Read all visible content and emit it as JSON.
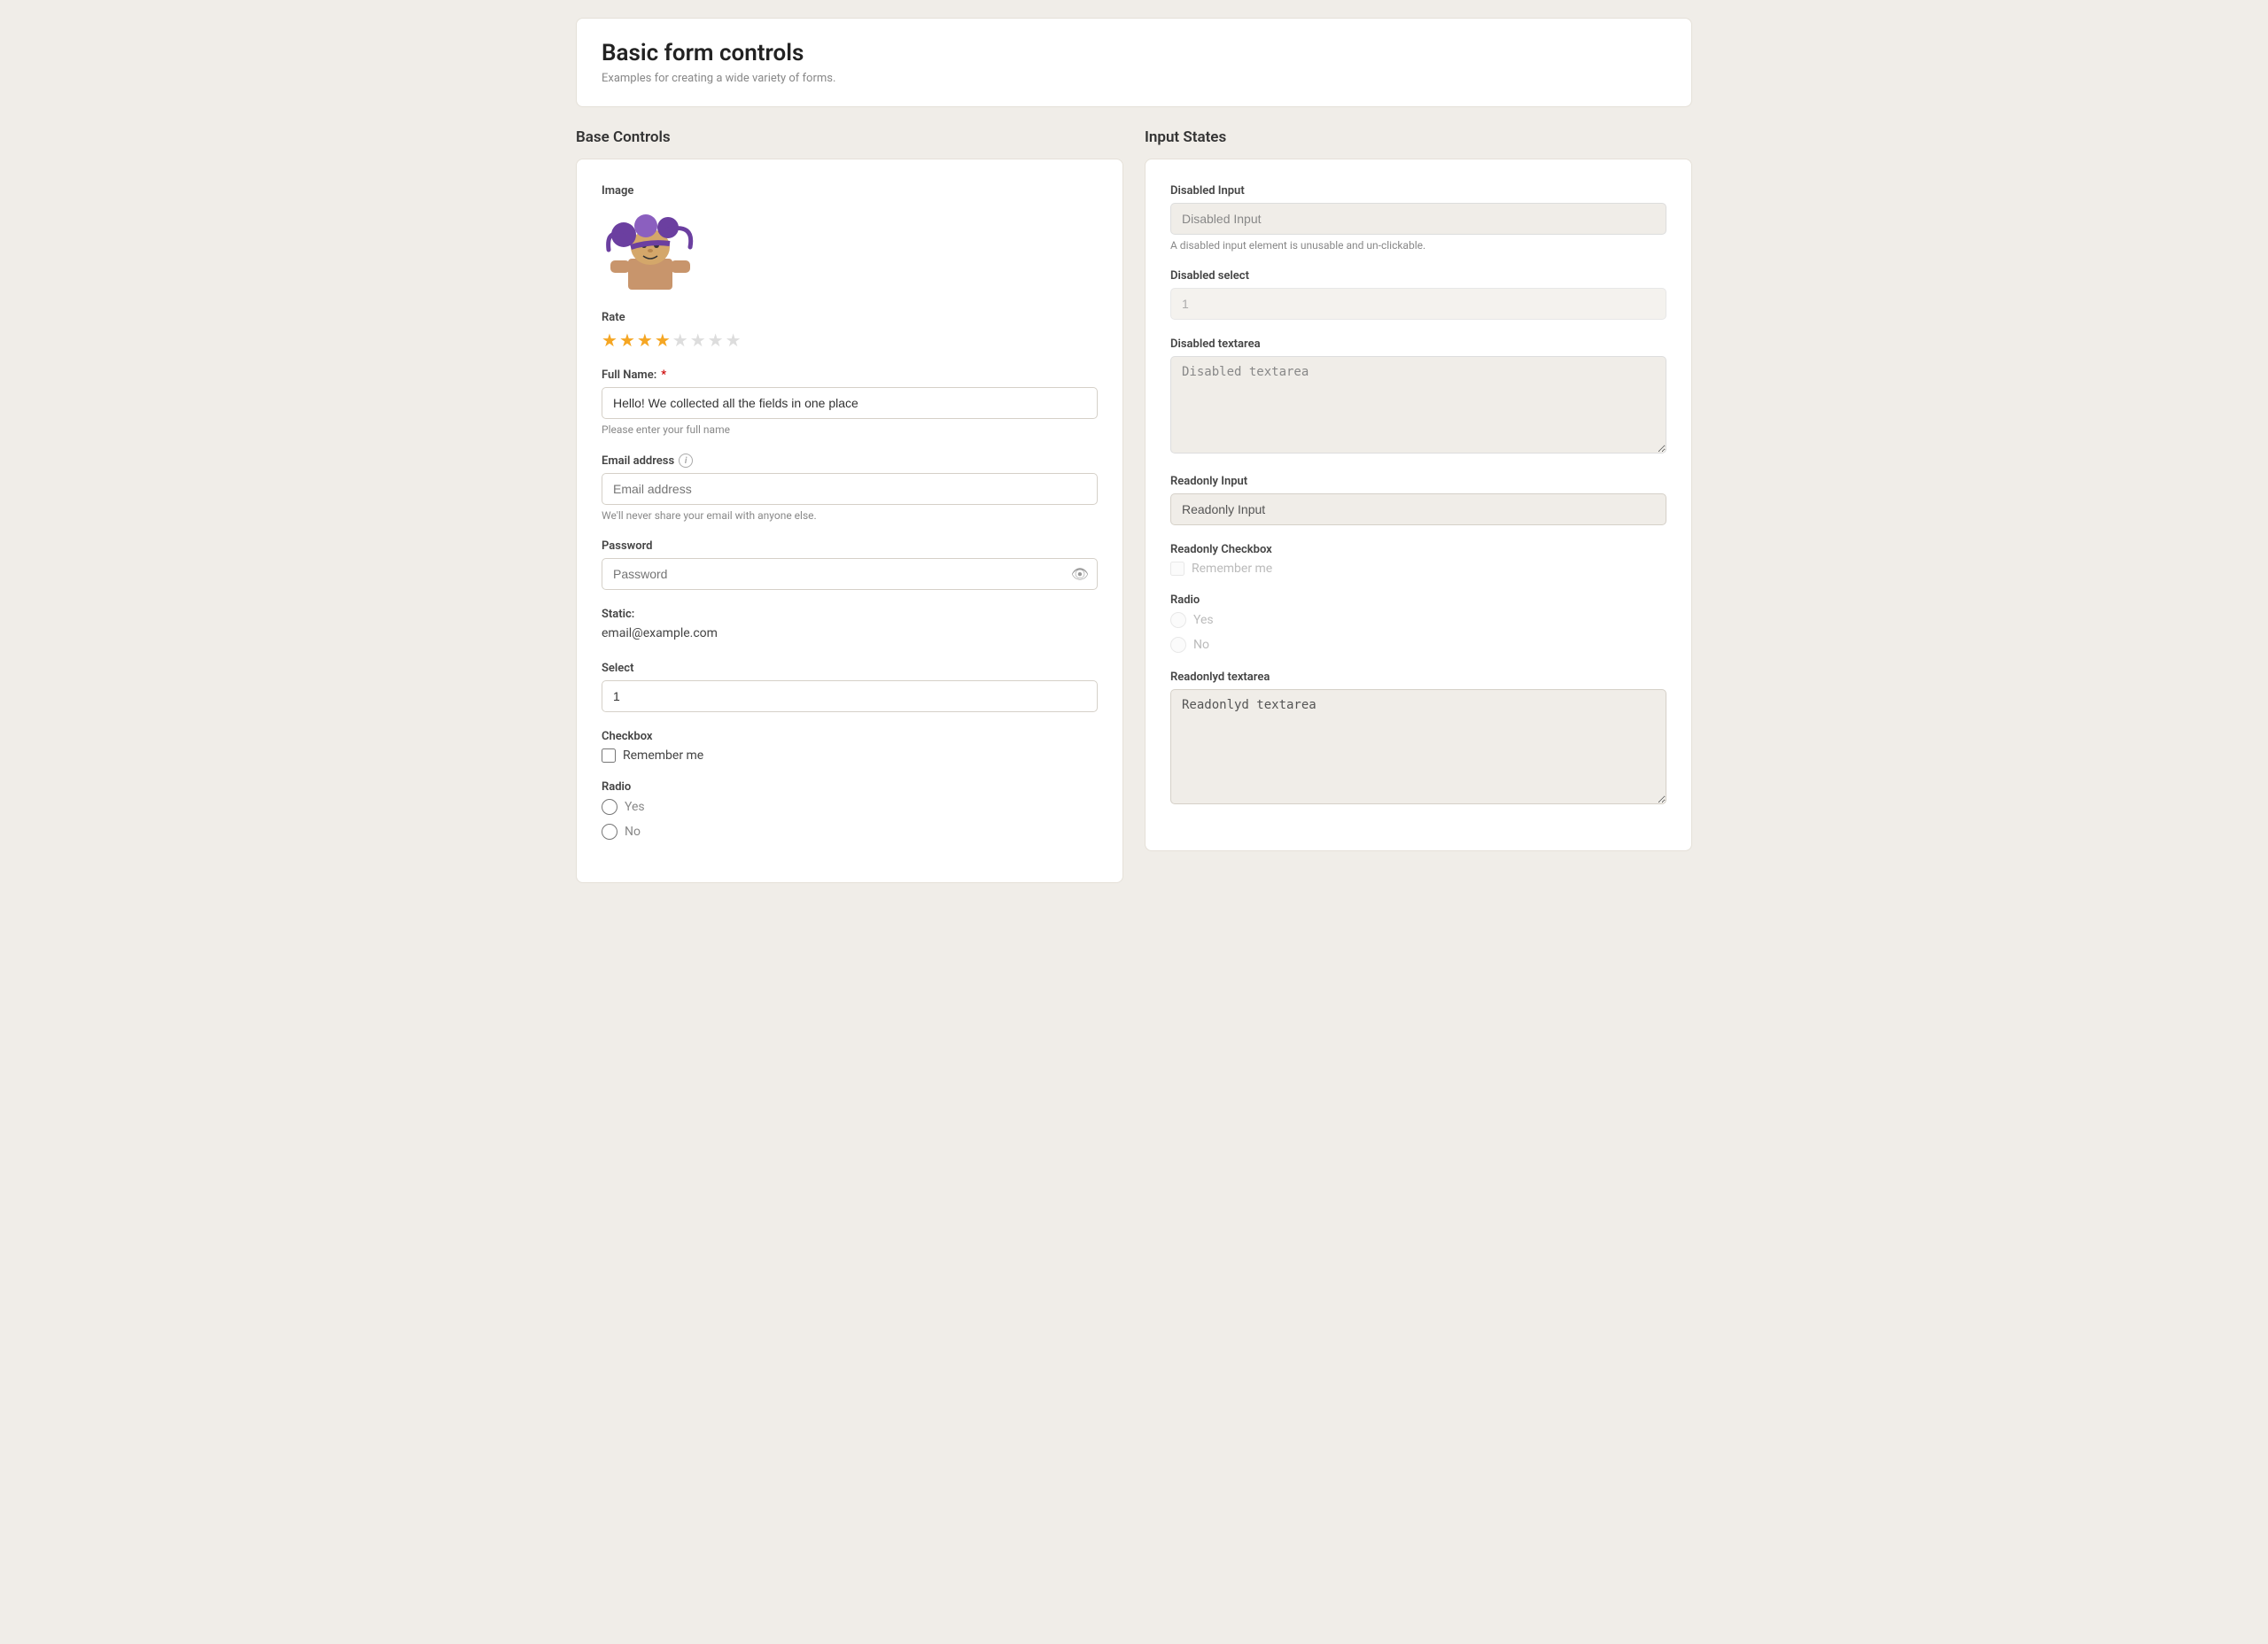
{
  "page": {
    "title": "Basic form controls",
    "subtitle": "Examples for creating a wide variety of forms."
  },
  "left_section": {
    "title": "Base Controls",
    "image_label": "Image",
    "rate_label": "Rate",
    "stars_filled": 4,
    "stars_total": 8,
    "full_name_label": "Full Name:",
    "full_name_required": "*",
    "full_name_value": "Hello! We collected all the fields in one place",
    "full_name_hint": "Please enter your full name",
    "email_label": "Email address",
    "email_placeholder": "Email address",
    "email_hint": "We'll never share your email with anyone else.",
    "password_label": "Password",
    "password_placeholder": "Password",
    "static_label": "Static:",
    "static_value": "email@example.com",
    "select_label": "Select",
    "select_value": "1",
    "checkbox_label": "Checkbox",
    "checkbox_text": "Remember me",
    "radio_label": "Radio",
    "radio_yes": "Yes",
    "radio_no": "No"
  },
  "right_section": {
    "title": "Input States",
    "disabled_input_label": "Disabled Input",
    "disabled_input_value": "Disabled Input",
    "disabled_input_hint": "A disabled input element is unusable and un-clickable.",
    "disabled_select_label": "Disabled select",
    "disabled_select_value": "1",
    "disabled_textarea_label": "Disabled textarea",
    "disabled_textarea_value": "Disabled textarea",
    "readonly_input_label": "Readonly Input",
    "readonly_input_value": "Readonly Input",
    "readonly_checkbox_label": "Readonly Checkbox",
    "readonly_checkbox_text": "Remember me",
    "radio_label": "Radio",
    "radio_yes": "Yes",
    "radio_no": "No",
    "readonlyd_textarea_label": "Readonlyd textarea",
    "readonlyd_textarea_value": "Readonlyd textarea"
  },
  "icons": {
    "eye": "👁",
    "info": "i",
    "star_filled": "★",
    "star_empty": "☆"
  }
}
